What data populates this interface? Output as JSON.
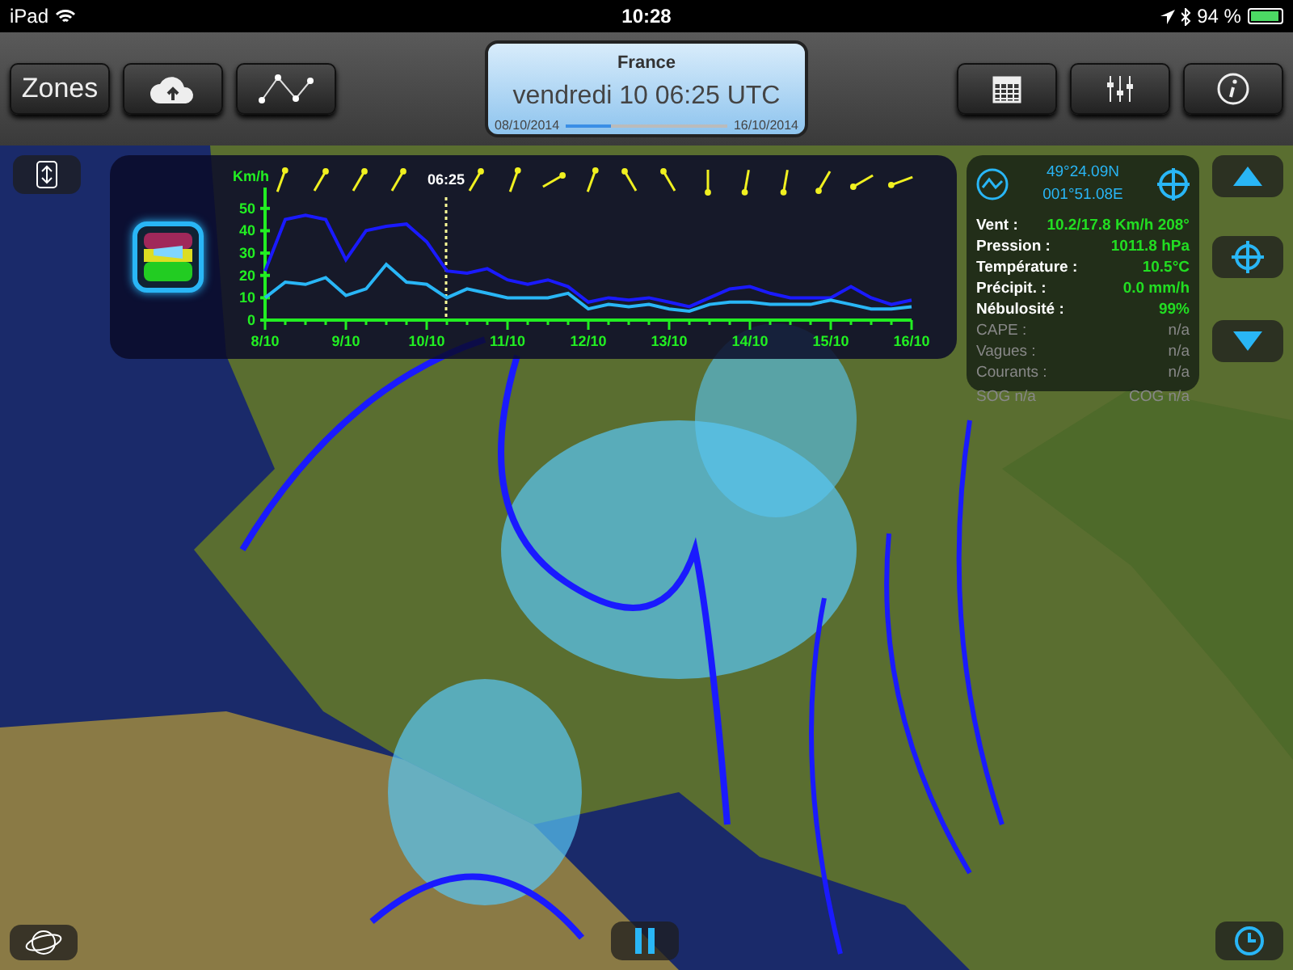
{
  "status_bar": {
    "device": "iPad",
    "time": "10:28",
    "battery": "94 %"
  },
  "toolbar": {
    "left_buttons": [
      {
        "kind": "text",
        "label": "Zones"
      },
      {
        "kind": "cloud"
      },
      {
        "kind": "route"
      }
    ],
    "date_panel": {
      "zone": "France",
      "datetime": "vendredi 10 06:25 UTC",
      "start": "08/10/2014",
      "end": "16/10/2014",
      "level": 0.28
    },
    "right_buttons": [
      {
        "kind": "calendar"
      },
      {
        "kind": "sliders"
      },
      {
        "kind": "info"
      }
    ]
  },
  "chart_panel": {
    "chart_data": {
      "type": "line",
      "ylabel": "Km/h",
      "ylim": [
        0,
        55
      ],
      "categories": [
        "8/10",
        null,
        null,
        null,
        "9/10",
        null,
        null,
        null,
        "10/10",
        null,
        null,
        null,
        "11/10",
        null,
        null,
        null,
        "12/10",
        null,
        null,
        null,
        "13/10",
        null,
        null,
        null,
        "14/10",
        null,
        null,
        null,
        "15/10",
        null,
        null,
        null,
        "16/10"
      ],
      "series": [
        {
          "color": "#1a1aff",
          "values": [
            22,
            45,
            47,
            45,
            27,
            40,
            42,
            43,
            35,
            22,
            21,
            23,
            18,
            16,
            18,
            15,
            8,
            10,
            9,
            10,
            8,
            6,
            10,
            14,
            15,
            12,
            10,
            10,
            10,
            15,
            10,
            7,
            9
          ]
        },
        {
          "color": "#29b6f6",
          "values": [
            10,
            17,
            16,
            19,
            11,
            14,
            25,
            17,
            16,
            10,
            14,
            12,
            10,
            10,
            10,
            12,
            5,
            7,
            6,
            7,
            5,
            4,
            7,
            8,
            8,
            7,
            7,
            7,
            9,
            7,
            5,
            5,
            6
          ]
        }
      ],
      "yticks": [
        0,
        10,
        20,
        30,
        40,
        50
      ]
    },
    "cursor_time": "06:25"
  },
  "info_panel": {
    "latitude": "49°24.09N",
    "longitude": "001°51.08E",
    "rows": [
      {
        "label": "Vent :",
        "value": "10.2/17.8 Km/h 208°",
        "disabled": false
      },
      {
        "label": "Pression :",
        "value": "1011.8 hPa",
        "disabled": false
      },
      {
        "label": "Température :",
        "value": "10.5°C",
        "disabled": false
      },
      {
        "label": "Précipit. :",
        "value": "0.0 mm/h",
        "disabled": false
      },
      {
        "label": "Nébulosité :",
        "value": "99%",
        "disabled": false
      },
      {
        "label": "CAPE :",
        "value": "n/a",
        "disabled": true
      },
      {
        "label": "Vagues :",
        "value": "n/a",
        "disabled": true
      },
      {
        "label": "Courants :",
        "value": "n/a",
        "disabled": true
      }
    ],
    "sog": "SOG n/a",
    "cog": "COG n/a"
  }
}
